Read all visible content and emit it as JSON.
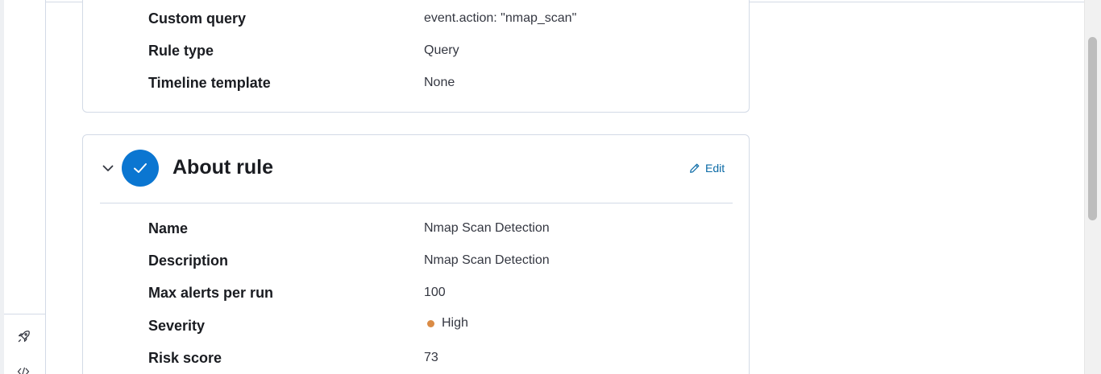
{
  "definition_panel": {
    "rows": [
      {
        "label": "Custom query",
        "value": "event.action: \"nmap_scan\""
      },
      {
        "label": "Rule type",
        "value": "Query"
      },
      {
        "label": "Timeline template",
        "value": "None"
      }
    ]
  },
  "about_panel": {
    "title": "About rule",
    "edit_label": "Edit",
    "rows": [
      {
        "label": "Name",
        "value": "Nmap Scan Detection"
      },
      {
        "label": "Description",
        "value": "Nmap Scan Detection"
      },
      {
        "label": "Max alerts per run",
        "value": "100"
      },
      {
        "label": "Severity",
        "value": "High"
      },
      {
        "label": "Risk score",
        "value": "73"
      }
    ]
  },
  "left_rail": {
    "icons": [
      "rocket-icon",
      "code-icon"
    ]
  },
  "colors": {
    "accent": "#0b76d1",
    "link": "#0a6aa6",
    "severity_high": "#da8b45",
    "border": "#d3dae6"
  }
}
